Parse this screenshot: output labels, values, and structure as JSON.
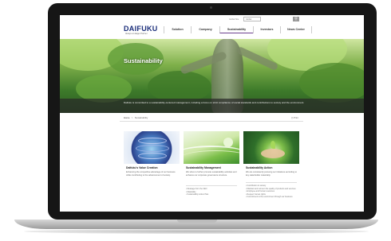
{
  "header": {
    "top_link": "Global Site",
    "language": "Global",
    "search_icon": "search-icon",
    "logo": "DAIFUKU",
    "tagline": "Always an Eager Partner"
  },
  "nav": {
    "items": [
      {
        "label": "Solution"
      },
      {
        "label": "Company"
      },
      {
        "label": "Sustainability"
      },
      {
        "label": "Investors"
      },
      {
        "label": "News Center"
      }
    ],
    "active_color": "#6b3f8f"
  },
  "hero": {
    "title": "Sustainability",
    "description": "Daifuku is committed to a sustainability-centered management, including a focus on strict compliance of social standards and contributions to society and the environment."
  },
  "breadcrumb": {
    "home": "Home",
    "current": "Sustainability",
    "print": "Print"
  },
  "cards": [
    {
      "title": "Daifuku's Value Creation",
      "description": "Enhancing the competitive advantage of our business while contributing to the advancement of society.",
      "list": []
    },
    {
      "title": "Sustainability Management",
      "description": "We strive to further promote sustainability activities and enhance our corporate governance structure.",
      "list": [
        "Message from the CEO",
        "Materiality",
        "Sustainability Action Plan"
      ]
    },
    {
      "title": "Sustainability Action",
      "description": "We are consistently pursuing our initiatives according to key stakeholder materiality.",
      "list": [
        "Contribution to society",
        "Maintain and reinvent the quality of products and services",
        "Employee and human resources",
        "Respect human rights",
        "Commitment to the environment through our business"
      ]
    }
  ],
  "colors": {
    "brand": "#1b2e7a",
    "laptop_frame": "#161616"
  }
}
